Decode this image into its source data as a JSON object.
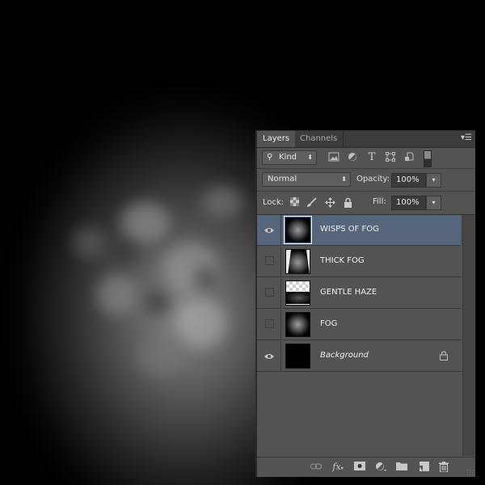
{
  "canvas": {
    "description": "fog texture on black background"
  },
  "panel": {
    "tabs": [
      {
        "label": "Layers",
        "active": true
      },
      {
        "label": "Channels",
        "active": false
      }
    ],
    "menu_icon": "panel-menu-icon",
    "filter": {
      "kind_label": "Kind",
      "icons": [
        "pixel-filter-icon",
        "adjustment-filter-icon",
        "type-filter-icon",
        "shape-filter-icon",
        "smart-object-filter-icon",
        "filter-toggle-icon"
      ]
    },
    "blend_mode": "Normal",
    "opacity_label": "Opacity:",
    "opacity_value": "100%",
    "lock_label": "Lock:",
    "lock_icons": [
      "lock-transparent-icon",
      "lock-image-icon",
      "lock-position-icon",
      "lock-all-icon"
    ],
    "fill_label": "Fill:",
    "fill_value": "100%",
    "layers": [
      {
        "name": "WISPS OF FOG",
        "visible": true,
        "selected": true,
        "locked": false,
        "italic": false,
        "thumb": "fog"
      },
      {
        "name": "THICK FOG",
        "visible": false,
        "selected": false,
        "locked": false,
        "italic": false,
        "thumb": "thickfog"
      },
      {
        "name": "GENTLE HAZE",
        "visible": false,
        "selected": false,
        "locked": false,
        "italic": false,
        "thumb": "haze"
      },
      {
        "name": "FOG",
        "visible": false,
        "selected": false,
        "locked": false,
        "italic": false,
        "thumb": "fog"
      },
      {
        "name": "Background",
        "visible": true,
        "selected": false,
        "locked": true,
        "italic": true,
        "thumb": "black"
      }
    ],
    "footer_icons": [
      "link-layers-icon",
      "fx-icon",
      "add-mask-icon",
      "adjustment-layer-icon",
      "new-group-icon",
      "new-layer-icon",
      "delete-icon"
    ],
    "colors": {
      "panel_bg": "#535353",
      "selected_row": "#56657a",
      "tabbar_bg": "#3c3c3c"
    }
  }
}
